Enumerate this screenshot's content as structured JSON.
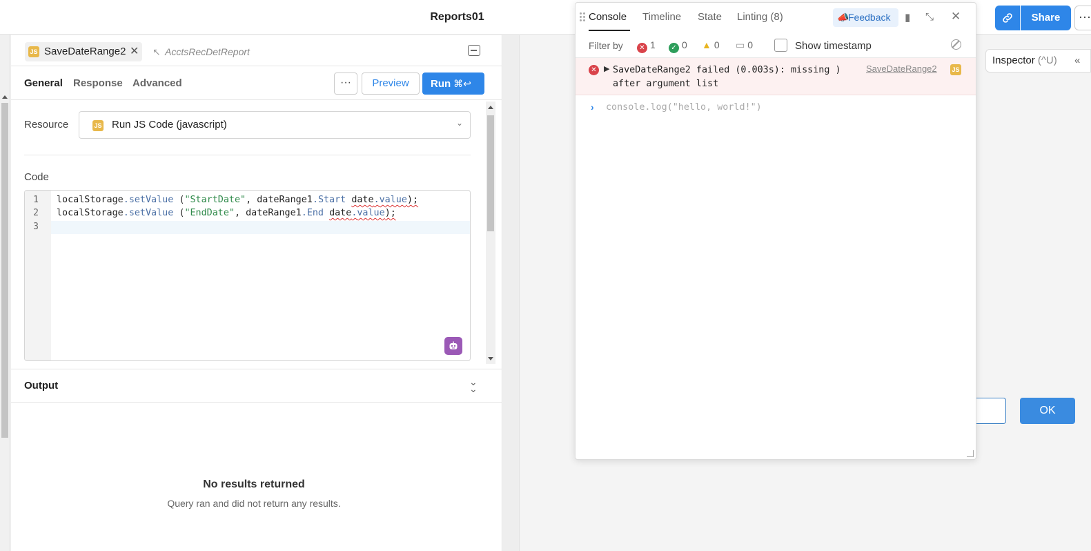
{
  "app": {
    "title": "Reports01"
  },
  "topbar": {
    "share_label": "Share",
    "more_label": "···"
  },
  "query_tab": {
    "badge": "JS",
    "name": "SaveDateRange2",
    "close": "✕",
    "linked": "AcctsRecDetReport"
  },
  "subtabs": [
    "General",
    "Response",
    "Advanced"
  ],
  "toolbar": {
    "more": "···",
    "preview": "Preview",
    "run": "Run",
    "run_kbd": "⌘↩"
  },
  "resource": {
    "label": "Resource",
    "badge": "JS",
    "value": "Run JS Code (javascript)"
  },
  "code": {
    "label": "Code",
    "line_numbers": [
      "1",
      "2",
      "3"
    ],
    "lines": [
      {
        "obj": "localStorage",
        "dot1": ".",
        "method": "setValue",
        "open": " (",
        "str": "\"StartDate\"",
        "mid": ", dateRange1",
        "dot2": ".",
        "prop1": "Start",
        "space": " ",
        "word": "date",
        "dot3": ".",
        "prop2": "value",
        "end": ");"
      },
      {
        "obj": "localStorage",
        "dot1": ".",
        "method": "setValue",
        "open": " (",
        "str": "\"EndDate\"",
        "mid": ", dateRange1",
        "dot2": ".",
        "prop1": "End",
        "space": " ",
        "word": "date",
        "dot3": ".",
        "prop2": "value",
        "end": ");"
      }
    ]
  },
  "output": {
    "title": "Output",
    "empty_title": "No results returned",
    "empty_sub": "Query ran and did not return any results."
  },
  "canvas": {
    "inspector_label": "Inspector",
    "inspector_hint": "(^U)",
    "inspector_chev": "«",
    "ok_label": "OK"
  },
  "console": {
    "tabs": [
      "Console",
      "Timeline",
      "State",
      "Linting (8)"
    ],
    "feedback": "Feedback",
    "filter_label": "Filter by",
    "counts": {
      "errors": "1",
      "success": "0",
      "warnings": "0",
      "messages": "0"
    },
    "show_timestamp": "Show timestamp",
    "error": {
      "message": "SaveDateRange2 failed (0.003s): missing ) after argument list",
      "source": "SaveDateRange2",
      "badge": "JS"
    },
    "prompt_placeholder": "console.log(\"hello, world!\")"
  },
  "colors": {
    "accent": "#2e86e8",
    "error": "#d9434a",
    "success": "#2e9e5b",
    "warning": "#e8b420",
    "js_badge": "#e8b84a"
  }
}
